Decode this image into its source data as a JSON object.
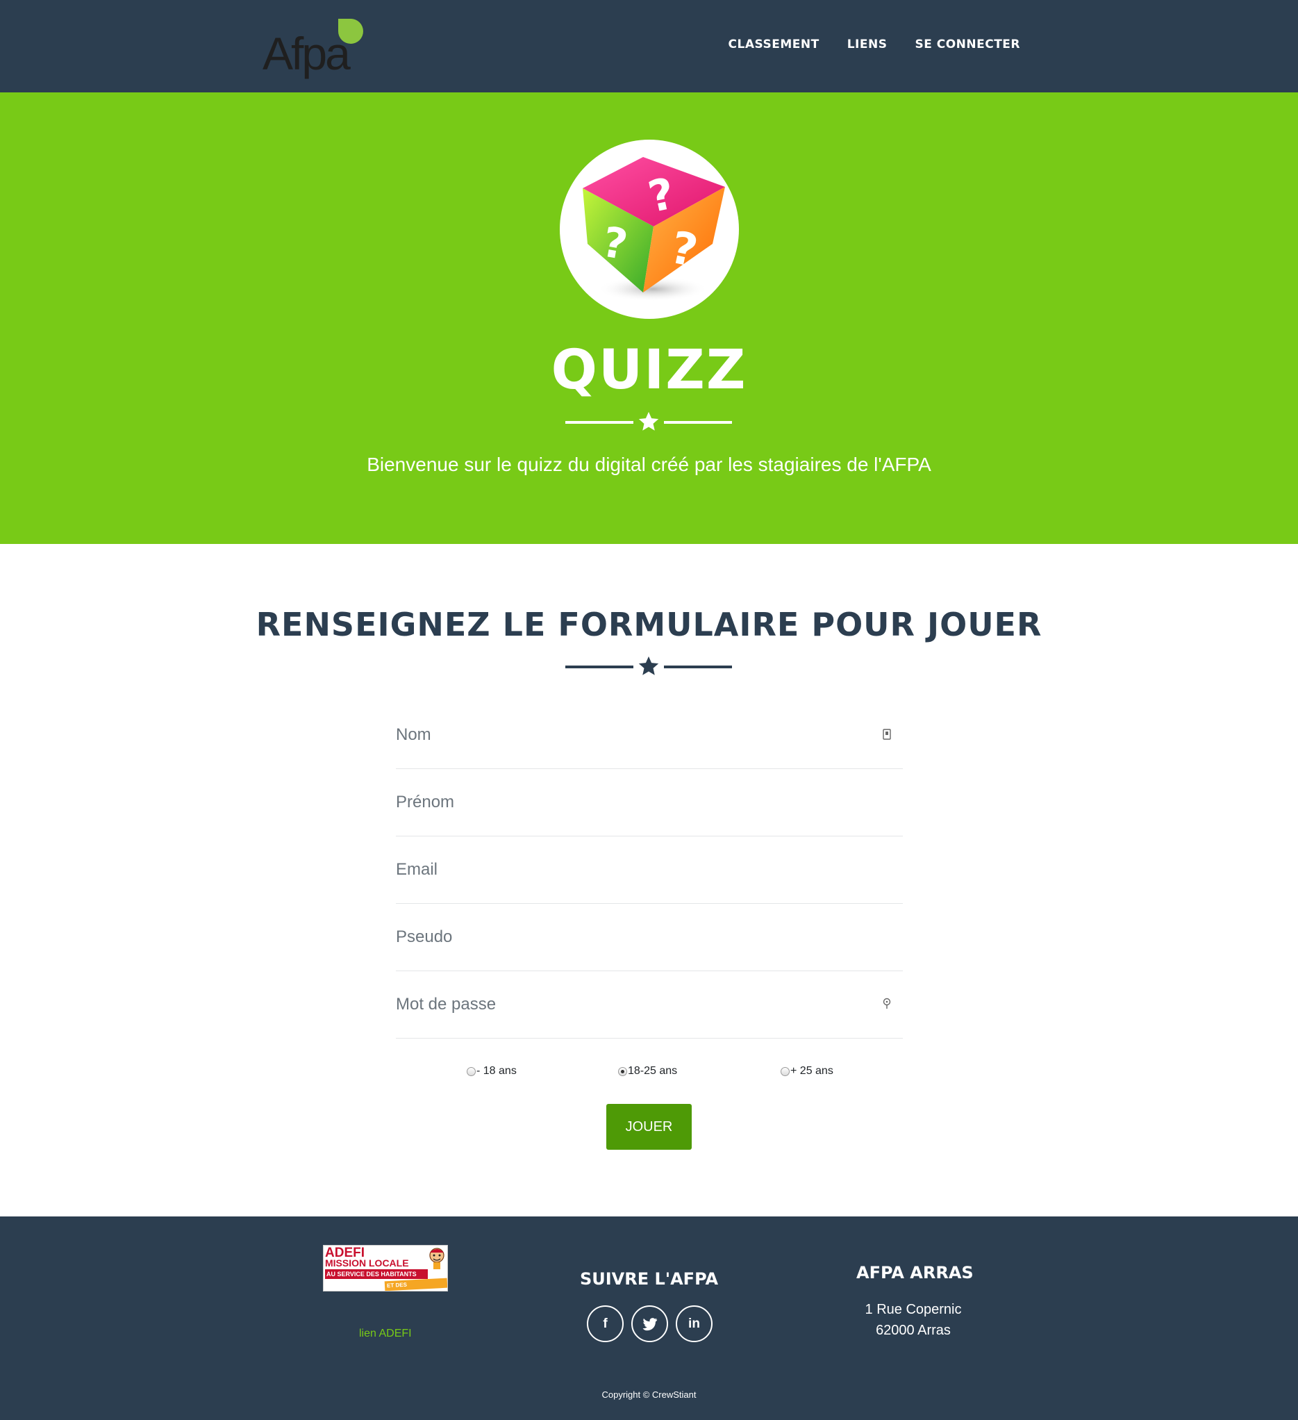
{
  "navbar": {
    "logo_text": "Afpa",
    "links": [
      "CLASSEMENT",
      "LIENS",
      "SE CONNECTER"
    ]
  },
  "masthead": {
    "title": "QUIZZ",
    "subtitle": "Bienvenue sur le quizz du digital créé par les stagiaires de l'AFPA",
    "image_icon": "question-cube-icon"
  },
  "form": {
    "title": "RENSEIGNEZ LE FORMULAIRE POUR JOUER",
    "fields": {
      "nom": {
        "placeholder": "Nom",
        "value": ""
      },
      "prenom": {
        "placeholder": "Prénom",
        "value": ""
      },
      "email": {
        "placeholder": "Email",
        "value": ""
      },
      "pseudo": {
        "placeholder": "Pseudo",
        "value": ""
      },
      "password": {
        "placeholder": "Mot de passe",
        "value": ""
      }
    },
    "age_options": [
      "- 18 ans",
      "18-25 ans",
      "+ 25 ans"
    ],
    "age_selected": "18-25 ans",
    "submit_label": "JOUER"
  },
  "footer": {
    "partner_logo": {
      "line1": "ADEFI",
      "line2": "MISSION LOCALE",
      "line3": "AU SERVICE DES HABITANTS",
      "line4": "ET DES ENTREPRISES"
    },
    "partner_link": "lien ADEFI",
    "follow_title": "SUIVRE L'AFPA",
    "socials": [
      {
        "label": "f",
        "icon": "facebook-icon"
      },
      {
        "label": "twitter",
        "icon": "twitter-icon"
      },
      {
        "label": "in",
        "icon": "linkedin-icon"
      }
    ],
    "address_title": "AFPA ARRAS",
    "address_line1": "1 Rue Copernic",
    "address_line2": "62000 Arras",
    "copyright": "Copyright © CrewStiant"
  },
  "colors": {
    "navbar": "#2c3e50",
    "masthead": "#78ca17",
    "button": "#4e9a06",
    "link": "#78ca17"
  }
}
